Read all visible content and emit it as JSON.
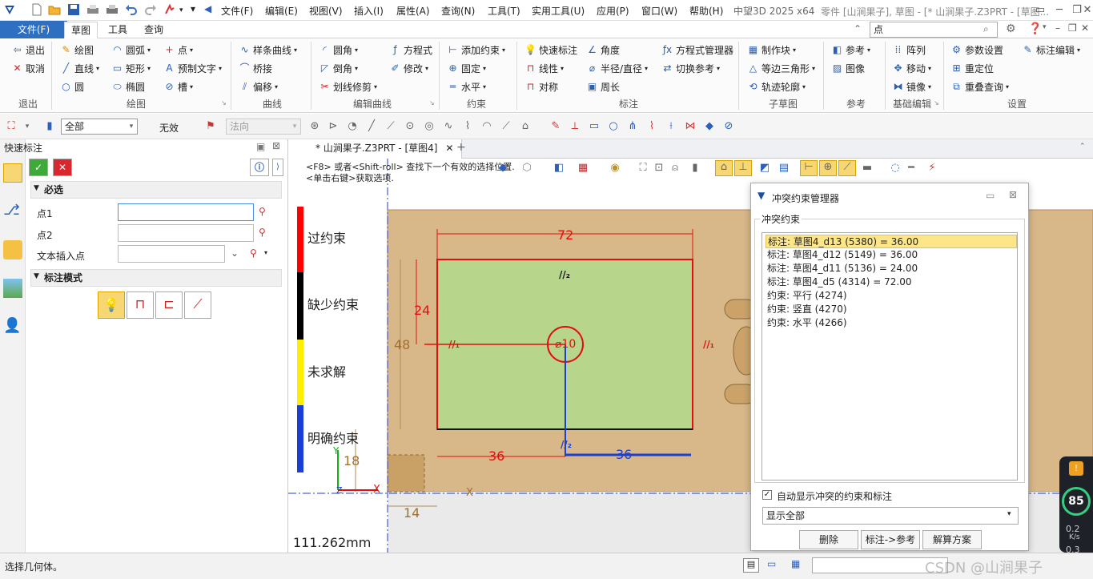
{
  "menu": [
    "文件(F)",
    "编辑(E)",
    "视图(V)",
    "插入(I)",
    "属性(A)",
    "查询(N)",
    "工具(T)",
    "实用工具(U)",
    "应用(P)",
    "窗口(W)",
    "帮助(H)"
  ],
  "app": {
    "name": "中望3D 2025 x64",
    "title": "零件 [山涧果子], 草图 - [* 山涧果子.Z3PRT - [草图..."
  },
  "tabs": {
    "file": "文件(F)",
    "items": [
      "草图",
      "工具",
      "查询"
    ]
  },
  "search": {
    "value": "点"
  },
  "ribbon": {
    "groups": [
      "退出",
      "绘图",
      "曲线",
      "编辑曲线",
      "约束",
      "标注",
      "子草图",
      "参考",
      "基础编辑",
      "设置"
    ],
    "exit": [
      "退出",
      "取消"
    ],
    "draw": [
      "绘图",
      "直线",
      "圆",
      "圆弧",
      "矩形",
      "椭圆",
      "点",
      "预制文字",
      "槽"
    ],
    "curve": [
      "样条曲线",
      "桥接",
      "偏移"
    ],
    "editcurve": [
      "圆角",
      "倒角",
      "划线修剪",
      "方程式",
      "修改"
    ],
    "constraint": [
      "添加约束",
      "固定",
      "水平"
    ],
    "dim": [
      "快速标注",
      "线性",
      "对称",
      "角度",
      "半径/直径",
      "周长",
      "方程式管理器",
      "切换参考"
    ],
    "subsketch": [
      "制作块",
      "等边三角形",
      "轨迹轮廓"
    ],
    "ref": [
      "参考",
      "图像"
    ],
    "basicedit": [
      "阵列",
      "移动",
      "镜像"
    ],
    "settings": [
      "参数设置",
      "重定位",
      "重叠查询",
      "标注编辑"
    ]
  },
  "toolbar2": {
    "filter": "全部",
    "invalid": "无效",
    "direction": "法向"
  },
  "leftpanel": {
    "title": "快速标注",
    "required": "必选",
    "point1": "点1",
    "point2": "点2",
    "textpoint": "文本插入点",
    "mode": "标注模式"
  },
  "doctab": "* 山涧果子.Z3PRT - [草图4]",
  "hint": {
    "line1": "<F8> 或者<Shift-roll> 查找下一个有效的选择位置.",
    "line2": "<单击右键>获取选项."
  },
  "legend": [
    {
      "label": "过约束",
      "color": "#ff0000"
    },
    {
      "label": "缺少约束",
      "color": "#000000"
    },
    {
      "label": "未求解",
      "color": "#ffee00"
    },
    {
      "label": "明确约束",
      "color": "#1a3fd6"
    }
  ],
  "dims": {
    "top": "72",
    "left24": "24",
    "left48": "48",
    "circle": "⌀10",
    "bottom_left": "36",
    "bottom_right": "36",
    "d18": "18",
    "d14": "14",
    "par_top": "//₂",
    "par_bottom": "//₂",
    "par_left": "//₁",
    "par_right": "//₁"
  },
  "measure": "111.262mm",
  "dialog": {
    "title": "冲突约束管理器",
    "section": "冲突约束",
    "items": [
      "标注: 草图4_d13 (5380) = 36.00",
      "标注: 草图4_d12 (5149) = 36.00",
      "标注: 草图4_d11 (5136) = 24.00",
      "标注: 草图4_d5 (4314) = 72.00",
      "约束: 平行 (4274)",
      "约束: 竖直 (4270)",
      "约束: 水平 (4266)"
    ],
    "checkbox": "自动显示冲突的约束和标注",
    "select": "显示全部",
    "buttons": [
      "删除",
      "标注->参考",
      "解算方案"
    ]
  },
  "status": {
    "text": "选择几何体。"
  },
  "perf": {
    "percent": "85",
    "speed": "0.2",
    "unit": "K/s",
    "speed2": "0.3"
  },
  "watermark": "CSDN @山涧果子"
}
